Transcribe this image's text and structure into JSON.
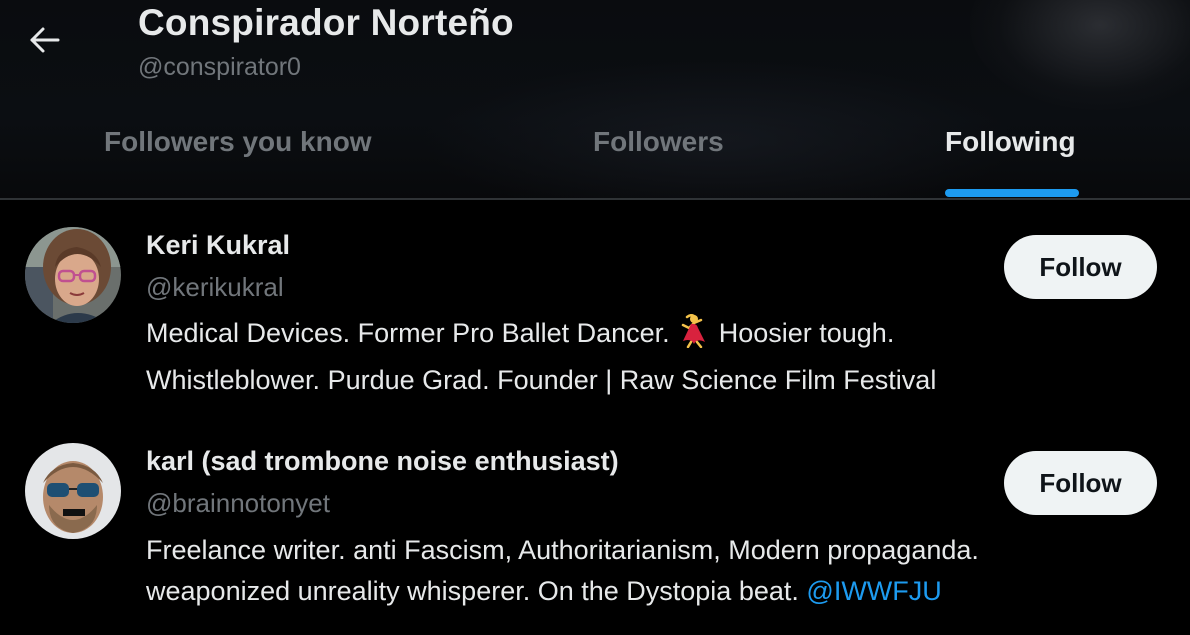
{
  "profile": {
    "name": "Conspirador Norteño",
    "handle": "@conspirator0"
  },
  "tabs": [
    {
      "label": "Followers you know",
      "active": false
    },
    {
      "label": "Followers",
      "active": false
    },
    {
      "label": "Following",
      "active": true
    }
  ],
  "users": [
    {
      "name": "Keri Kukral",
      "handle": "@kerikukral",
      "bio_line1_a": "Medical Devices. Former Pro Ballet Dancer.",
      "bio_emoji": "dancer-emoji",
      "bio_line1_b": "Hoosier tough.",
      "bio_line2": "Whistleblower. Purdue Grad. Founder | Raw Science Film Festival",
      "follow_label": "Follow"
    },
    {
      "name": "karl (sad trombone noise enthusiast)",
      "handle": "@brainnotonyet",
      "bio_line1": "Freelance writer. anti Fascism, Authoritarianism, Modern propaganda.",
      "bio_line2": "weaponized unreality whisperer. On the Dystopia beat.",
      "bio_mention": "@IWWFJU",
      "follow_label": "Follow"
    }
  ],
  "icons": {
    "back": "arrow-left-icon"
  },
  "colors": {
    "accent": "#1d9bf0",
    "text_primary": "#e7e9ea",
    "text_secondary": "#71767b",
    "background": "#000000",
    "button_bg": "#eff3f4",
    "divider": "#2f3336"
  }
}
